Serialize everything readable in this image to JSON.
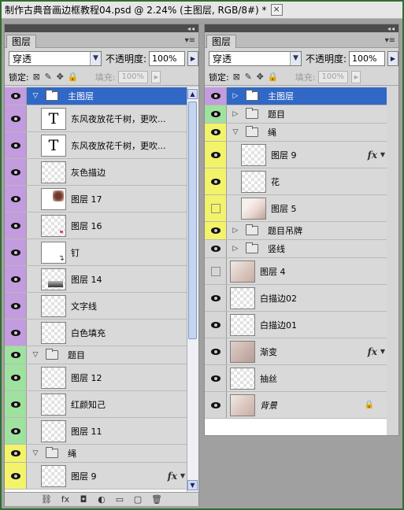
{
  "document_title": "制作古典音画边框教程04.psd @ 2.24% (主图层, RGB/8#) *",
  "close_glyph": "×",
  "panel_common": {
    "tab_label": "图层",
    "blend_mode": "穿透",
    "opacity_label": "不透明度:",
    "opacity_value": "100%",
    "lock_label": "锁定:",
    "fill_label": "填充:",
    "fill_value": "100%",
    "collapse_glyph": "◂◂",
    "menu_glyph": "▾≡"
  },
  "left_panel": {
    "layers": [
      {
        "type": "folder",
        "name": "主图层",
        "expanded": true,
        "color": "#c39bdf",
        "visible": true,
        "selected": true,
        "indent": 0
      },
      {
        "type": "text",
        "name": "东风夜放花千树，更吹...",
        "color": "#c39bdf",
        "visible": true,
        "indent": 1,
        "thumb": "T"
      },
      {
        "type": "text",
        "name": "东风夜放花千树，更吹...",
        "color": "#c39bdf",
        "visible": true,
        "indent": 1,
        "thumb": "T"
      },
      {
        "type": "layer",
        "name": "灰色描边",
        "color": "#c39bdf",
        "visible": true,
        "indent": 1,
        "thumb_style": "checker"
      },
      {
        "type": "layer",
        "name": "图层 17",
        "color": "#c39bdf",
        "visible": true,
        "indent": 1,
        "thumb_style": "img17"
      },
      {
        "type": "layer",
        "name": "图层 16",
        "color": "#c39bdf",
        "visible": true,
        "indent": 1,
        "thumb_style": "pinkdot"
      },
      {
        "type": "layer",
        "name": "钉",
        "color": "#c39bdf",
        "visible": true,
        "indent": 1,
        "thumb_style": "nail"
      },
      {
        "type": "layer",
        "name": "图层 14",
        "color": "#c39bdf",
        "visible": true,
        "indent": 1,
        "thumb_style": "grad14"
      },
      {
        "type": "layer",
        "name": "文字线",
        "color": "#c39bdf",
        "visible": true,
        "indent": 1,
        "thumb_style": "checker"
      },
      {
        "type": "layer",
        "name": "白色填充",
        "color": "#c39bdf",
        "visible": true,
        "indent": 1,
        "thumb_style": "checker"
      },
      {
        "type": "folder",
        "name": "题目",
        "expanded": true,
        "color": "#9fe29f",
        "visible": true,
        "indent": 0
      },
      {
        "type": "layer",
        "name": "图层 12",
        "color": "#9fe29f",
        "visible": true,
        "indent": 1,
        "thumb_style": "checker"
      },
      {
        "type": "layer",
        "name": "红颜知己",
        "color": "#9fe29f",
        "visible": true,
        "indent": 1,
        "thumb_style": "checker"
      },
      {
        "type": "layer",
        "name": "图层 11",
        "color": "#9fe29f",
        "visible": true,
        "indent": 1,
        "thumb_style": "checker"
      },
      {
        "type": "folder",
        "name": "绳",
        "expanded": true,
        "color": "#f3f36a",
        "visible": true,
        "indent": 0
      },
      {
        "type": "layer",
        "name": "图层 9",
        "color": "#f3f36a",
        "visible": true,
        "indent": 1,
        "thumb_style": "checker",
        "fx": true
      }
    ]
  },
  "right_panel": {
    "layers": [
      {
        "type": "folder",
        "name": "主图层",
        "expanded": false,
        "color": "#c39bdf",
        "visible": true,
        "selected": true,
        "indent": 0
      },
      {
        "type": "folder",
        "name": "题目",
        "expanded": false,
        "color": "#9fe29f",
        "visible": true,
        "indent": 0
      },
      {
        "type": "folder",
        "name": "绳",
        "expanded": true,
        "color": "#f3f36a",
        "visible": true,
        "indent": 0
      },
      {
        "type": "layer",
        "name": "图层 9",
        "color": "#f3f36a",
        "visible": true,
        "indent": 1,
        "thumb_style": "checker",
        "fx": true
      },
      {
        "type": "layer",
        "name": "花",
        "color": "#f3f36a",
        "visible": true,
        "indent": 1,
        "thumb_style": "checker"
      },
      {
        "type": "layer",
        "name": "图层 5",
        "color": "#f3f36a",
        "visible": false,
        "indent": 1,
        "thumb_style": "flower"
      },
      {
        "type": "folder",
        "name": "题目吊牌",
        "expanded": false,
        "color": "#f3f36a",
        "visible": true,
        "indent": 0
      },
      {
        "type": "folder",
        "name": "竖线",
        "expanded": false,
        "color": "#d6d6d6",
        "visible": true,
        "indent": 0
      },
      {
        "type": "layer",
        "name": "图层 4",
        "color": "#d6d6d6",
        "visible": false,
        "indent": 0,
        "thumb_style": "photo"
      },
      {
        "type": "layer",
        "name": "白描边02",
        "color": "#d6d6d6",
        "visible": true,
        "indent": 0,
        "thumb_style": "checker"
      },
      {
        "type": "layer",
        "name": "白描边01",
        "color": "#d6d6d6",
        "visible": true,
        "indent": 0,
        "thumb_style": "checker"
      },
      {
        "type": "layer",
        "name": "渐变",
        "color": "#d6d6d6",
        "visible": true,
        "indent": 0,
        "thumb_style": "photo-dark",
        "fx": true
      },
      {
        "type": "layer",
        "name": "抽丝",
        "color": "#d6d6d6",
        "visible": true,
        "indent": 0,
        "thumb_style": "checker"
      },
      {
        "type": "layer",
        "name": "背景",
        "color": "#d6d6d6",
        "visible": true,
        "indent": 0,
        "thumb_style": "photo",
        "locked": true,
        "italic": true
      }
    ]
  },
  "bottom_buttons": [
    "⛓",
    "fx",
    "◘",
    "◐",
    "▭",
    "▢",
    "🗑"
  ]
}
